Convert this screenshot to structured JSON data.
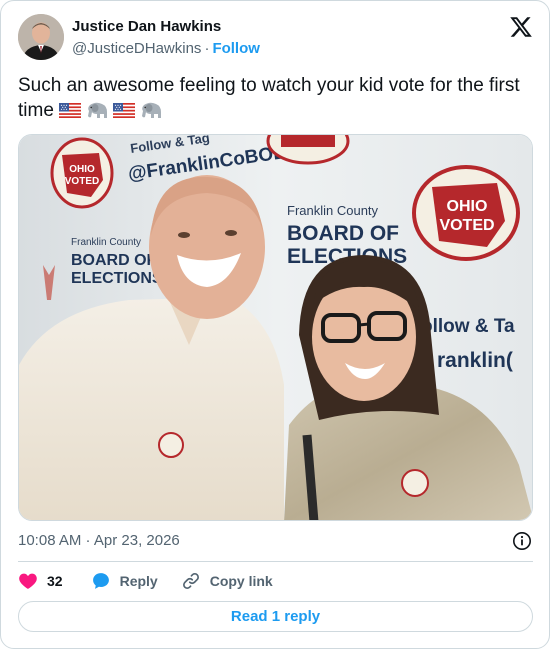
{
  "author": {
    "name": "Justice Dan Hawkins",
    "handle": "@JusticeDHawkins",
    "separator": "·",
    "follow_label": "Follow"
  },
  "tweet": {
    "text": "Such an awesome feeling to watch your kid vote for the first time",
    "emojis": [
      "us-flag-emoji",
      "elephant-emoji",
      "us-flag-emoji",
      "elephant-emoji"
    ]
  },
  "photo": {
    "banner": {
      "follow_text": "Follow & Tag",
      "handle_text": "@FranklinCoBOE",
      "org_line1": "Franklin County",
      "org_line2": "BOARD OF",
      "org_line3": "ELECTIONS",
      "sticker_top": "OHIO",
      "sticker_bottom": "VOTED",
      "partial_follow": "ollow & Ta",
      "partial_handle": "ranklin("
    }
  },
  "meta": {
    "timestamp": "10:08 AM · Apr 23, 2026"
  },
  "actions": {
    "likes_count": "32",
    "reply_label": "Reply",
    "copy_link_label": "Copy link"
  },
  "read_replies_label": "Read 1 reply",
  "colors": {
    "accent": "#1d9bf0",
    "like": "#f91880",
    "muted": "#536471",
    "border": "#cfd9de",
    "sticker_red": "#b5282c"
  }
}
